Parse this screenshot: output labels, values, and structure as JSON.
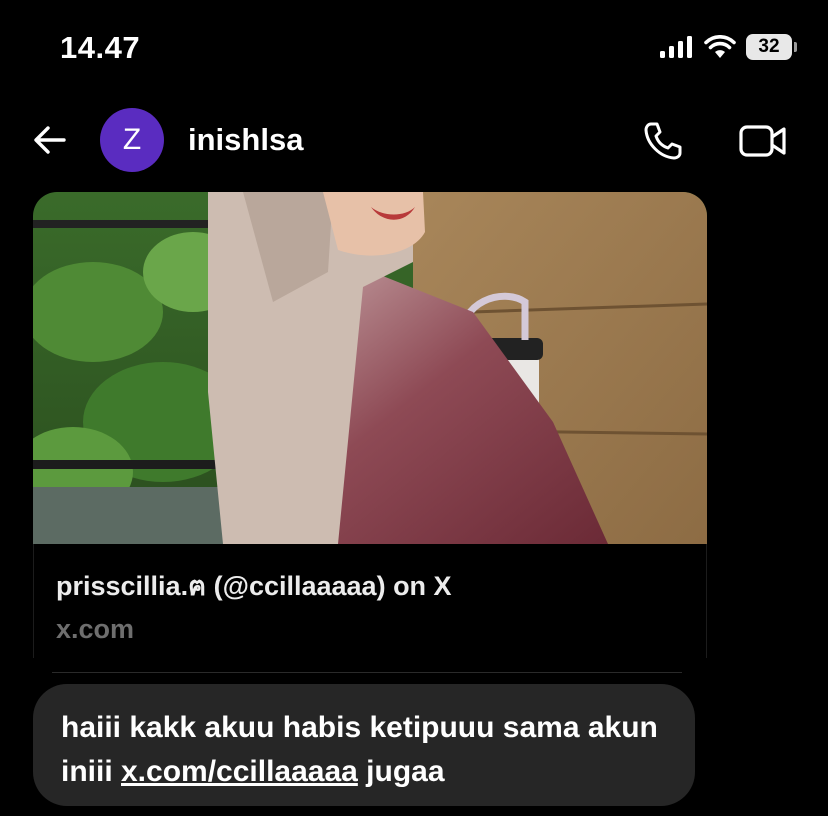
{
  "status_bar": {
    "time": "14.47",
    "battery_level": "32"
  },
  "header": {
    "avatar_initial": "Z",
    "username": "inishlsa"
  },
  "link_preview": {
    "title": "prisscillia.ฅ (@ccillaaaaa) on X",
    "domain": "x.com"
  },
  "message": {
    "text_before": "haiii kakk  akuu habis ketipuuu sama akun iniii ",
    "link": "x.com/ccillaaaaa",
    "text_after": " jugaa"
  }
}
